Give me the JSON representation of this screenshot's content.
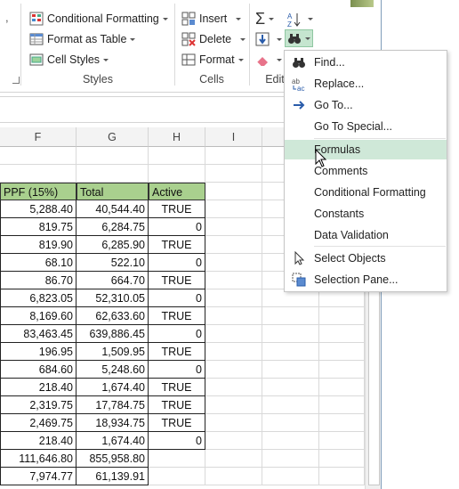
{
  "ribbon": {
    "styles": {
      "conditional_formatting": "Conditional Formatting",
      "format_as_table": "Format as Table",
      "cell_styles": "Cell Styles",
      "group_label": "Styles"
    },
    "cells": {
      "insert": "Insert",
      "delete": "Delete",
      "format": "Format",
      "group_label": "Cells"
    },
    "editing": {
      "group_label": "Edit"
    },
    "clipped_left_char": ","
  },
  "grid": {
    "columns": [
      "F",
      "G",
      "H",
      "I"
    ],
    "headers": [
      "PPF (15%)",
      "Total",
      "Active"
    ],
    "rows": [
      [
        "5,288.40",
        "40,544.40",
        "TRUE"
      ],
      [
        "819.75",
        "6,284.75",
        "0"
      ],
      [
        "819.90",
        "6,285.90",
        "TRUE"
      ],
      [
        "68.10",
        "522.10",
        "0"
      ],
      [
        "86.70",
        "664.70",
        "TRUE"
      ],
      [
        "6,823.05",
        "52,310.05",
        "0"
      ],
      [
        "8,169.60",
        "62,633.60",
        "TRUE"
      ],
      [
        "83,463.45",
        "639,886.45",
        "0"
      ],
      [
        "196.95",
        "1,509.95",
        "TRUE"
      ],
      [
        "684.60",
        "5,248.60",
        "0"
      ],
      [
        "218.40",
        "1,674.40",
        "TRUE"
      ],
      [
        "2,319.75",
        "17,784.75",
        "TRUE"
      ],
      [
        "2,469.75",
        "18,934.75",
        "TRUE"
      ],
      [
        "218.40",
        "1,674.40",
        "0"
      ],
      [
        "111,646.80",
        "855,958.80",
        ""
      ],
      [
        "7,974.77",
        "61,139.91",
        ""
      ]
    ]
  },
  "menu": {
    "items": [
      {
        "label": "Find...",
        "icon": "binoculars-icon"
      },
      {
        "label": "Replace...",
        "icon": "replace-icon"
      },
      {
        "label": "Go To...",
        "icon": "arrow-right-icon"
      },
      {
        "label": "Go To Special...",
        "icon": ""
      },
      {
        "label": "Formulas",
        "icon": "",
        "highlighted": true
      },
      {
        "label": "Comments",
        "icon": ""
      },
      {
        "label": "Conditional Formatting",
        "icon": ""
      },
      {
        "label": "Constants",
        "icon": ""
      },
      {
        "label": "Data Validation",
        "icon": ""
      },
      {
        "label": "Select Objects",
        "icon": "cursor-arrow-icon"
      },
      {
        "label": "Selection Pane...",
        "icon": "selection-pane-icon"
      }
    ]
  },
  "colors": {
    "header_fill": "#a9d08e",
    "highlight": "#cfe8d8"
  }
}
